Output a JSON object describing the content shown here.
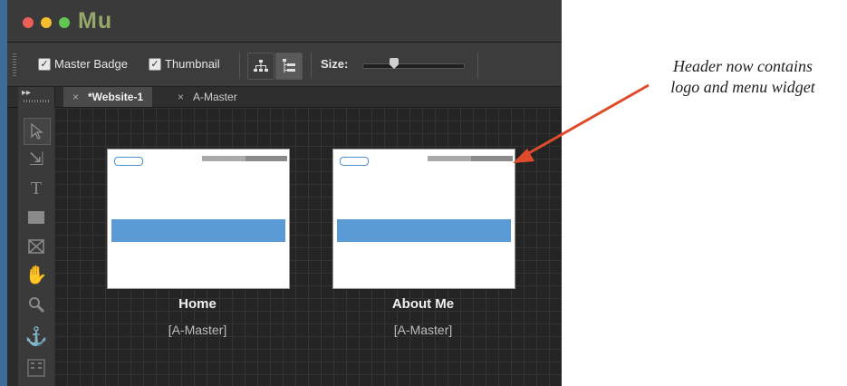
{
  "app": {
    "name": "Mu"
  },
  "toolbar": {
    "master_badge": {
      "label": "Master Badge",
      "checked": true
    },
    "thumbnail": {
      "label": "Thumbnail",
      "checked": true
    },
    "size_label": "Size:",
    "size_value": 0.32
  },
  "tabs": [
    {
      "label": "*Website-1",
      "active": true
    },
    {
      "label": "A-Master",
      "active": false
    }
  ],
  "tools": [
    "selection-tool",
    "crop-tool",
    "text-tool",
    "rectangle-tool",
    "image-frame-tool",
    "hand-tool",
    "zoom-tool",
    "anchor-tool",
    "grid-tool"
  ],
  "pages": [
    {
      "title": "Home",
      "master": "[A-Master]"
    },
    {
      "title": "About Me",
      "master": "[A-Master]"
    }
  ],
  "annotation": {
    "line1": "Header now contains",
    "line2": "logo and menu widget",
    "color": "#e04b2c"
  },
  "colors": {
    "accent_band": "#5b9bd5",
    "app_logo": "#95a86a"
  }
}
